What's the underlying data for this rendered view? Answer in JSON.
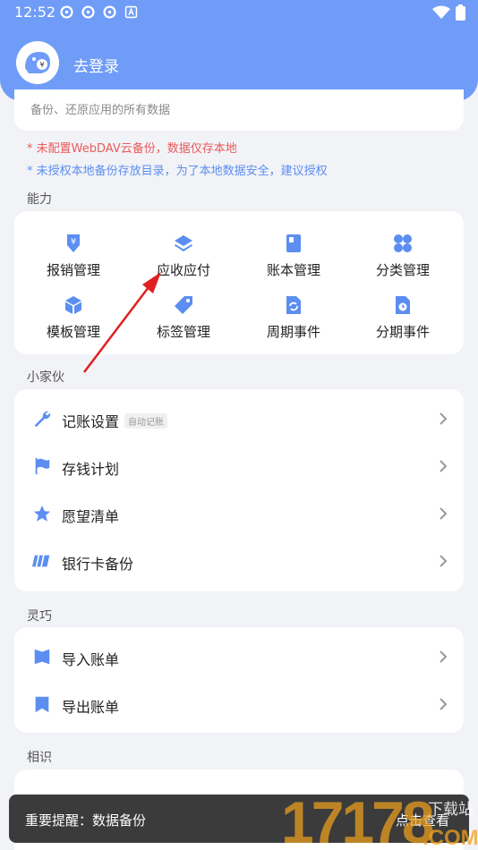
{
  "status_bar": {
    "time": "12:52"
  },
  "header": {
    "login_label": "去登录"
  },
  "backup": {
    "description": "备份、还原应用的所有数据",
    "warning_webdav": "* 未配置WebDAV云备份，数据仅存本地",
    "warning_local": "* 未授权本地备份存放目录，为了本地数据安全，建议授权"
  },
  "abilities": {
    "title": "能力",
    "items": [
      {
        "label": "报销管理",
        "icon": "reimburse-icon"
      },
      {
        "label": "应收应付",
        "icon": "layers-icon"
      },
      {
        "label": "账本管理",
        "icon": "ledger-book-icon"
      },
      {
        "label": "分类管理",
        "icon": "category-grid-icon"
      },
      {
        "label": "模板管理",
        "icon": "template-cube-icon"
      },
      {
        "label": "标签管理",
        "icon": "tag-icon"
      },
      {
        "label": "周期事件",
        "icon": "cycle-doc-icon"
      },
      {
        "label": "分期事件",
        "icon": "installment-doc-icon"
      }
    ]
  },
  "widgets": {
    "title": "小家伙",
    "items": [
      {
        "label": "记账设置",
        "badge": "自动记账",
        "icon": "wrench-icon"
      },
      {
        "label": "存钱计划",
        "icon": "flag-icon"
      },
      {
        "label": "愿望清单",
        "icon": "star-icon"
      },
      {
        "label": "银行卡备份",
        "icon": "bank-card-icon"
      }
    ]
  },
  "flexible": {
    "title": "灵巧",
    "items": [
      {
        "label": "导入账单",
        "icon": "import-bookmark-icon"
      },
      {
        "label": "导出账单",
        "icon": "export-bookmark-icon"
      }
    ]
  },
  "acquaint": {
    "title": "相识"
  },
  "toast": {
    "message": "重要提醒：数据备份",
    "action": "点击查看"
  },
  "watermark": {
    "text": "17178",
    "sub": "下载站",
    "domain": ".COM"
  },
  "colors": {
    "accent": "#6f9cf6",
    "icon": "#5b8ef0",
    "warning": "#ea5a5a",
    "annotation": "#e02020"
  }
}
